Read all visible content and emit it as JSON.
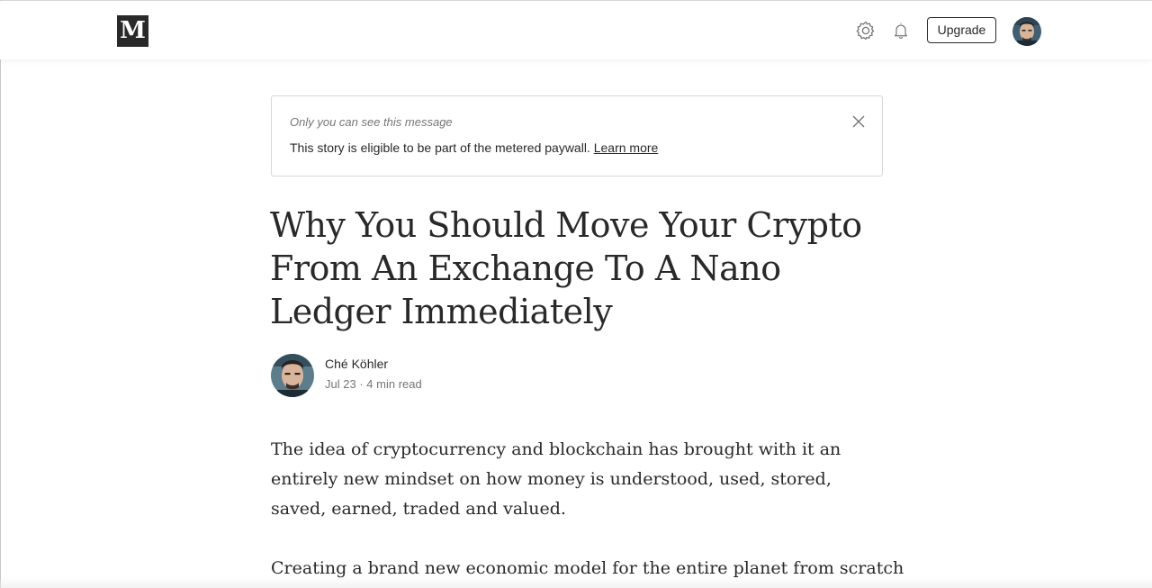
{
  "header": {
    "logo_text": "M",
    "upgrade_label": "Upgrade",
    "icons": [
      "gear-icon",
      "bell-icon"
    ]
  },
  "notice": {
    "title": "Only you can see this message",
    "body": "This story is eligible to be part of the metered paywall.",
    "link_label": "Learn more"
  },
  "article": {
    "title": "Why You Should Move Your Crypto From An Exchange To A Nano Ledger Immediately",
    "author_name": "Ché Köhler",
    "date": "Jul 23",
    "separator": "·",
    "read_time": "4 min read",
    "paragraphs": [
      "The idea of cryptocurrency and blockchain has brought with it an entirely new mindset on how money is understood, used, stored, saved, earned, traded and valued.",
      "Creating a brand new economic model for the entire planet from scratch"
    ]
  },
  "colors": {
    "text": "#292929",
    "muted": "#757575",
    "border": "#d6d6d6",
    "logo_bg": "#292929"
  }
}
